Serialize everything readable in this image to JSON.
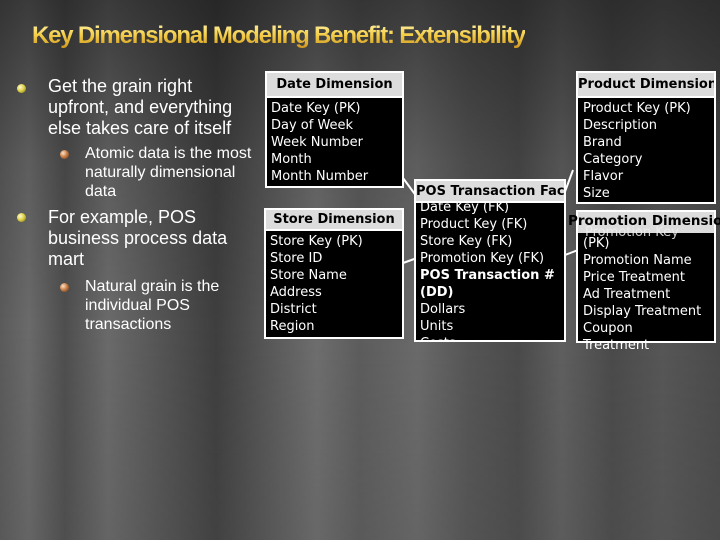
{
  "slide": {
    "title": "Key Dimensional Modeling Benefit: Extensibility",
    "bullets": [
      {
        "text": "Get the grain right upfront, and everything else takes care of itself",
        "sub": [
          "Atomic data is the most naturally dimensional data"
        ]
      },
      {
        "text": "For example, POS business process data mart",
        "sub": [
          "Natural grain is the individual POS transactions"
        ]
      }
    ]
  },
  "diagram": {
    "date_dimension": {
      "title": "Date Dimension",
      "fields": [
        "Date Key (PK)",
        "Day of Week",
        "Week Number",
        "Month",
        "Month Number"
      ]
    },
    "store_dimension": {
      "title": "Store Dimension",
      "fields": [
        "Store Key (PK)",
        "Store ID",
        "Store Name",
        "Address",
        "District",
        "Region"
      ]
    },
    "pos_transaction_fact": {
      "title": "POS Transaction Fact",
      "fields": [
        "Date Key (FK)",
        "Product Key (FK)",
        "Store Key (FK)",
        "Promotion Key (FK)",
        "POS Transaction # (DD)",
        "Dollars",
        "Units",
        "Costs"
      ],
      "bold_field": "POS Transaction # (DD)",
      "bold_field_line1": "POS Transaction #",
      "bold_field_line2": "(DD)"
    },
    "product_dimension": {
      "title": "Product Dimension",
      "fields": [
        "Product Key (PK)",
        "Description",
        "Brand",
        "Category",
        "Flavor",
        "Size"
      ]
    },
    "promotion_dimension": {
      "title": "Promotion Dimension",
      "fields": [
        "Promotion Key (PK)",
        "Promotion Name",
        "Price Treatment",
        "Ad Treatment",
        "Display Treatment",
        "Coupon Treatment"
      ],
      "field_wrapped_1a": "Promotion Key",
      "field_wrapped_1b": "(PK)",
      "field_wrapped_6a": "Coupon",
      "field_wrapped_6b": "Treatment"
    }
  }
}
